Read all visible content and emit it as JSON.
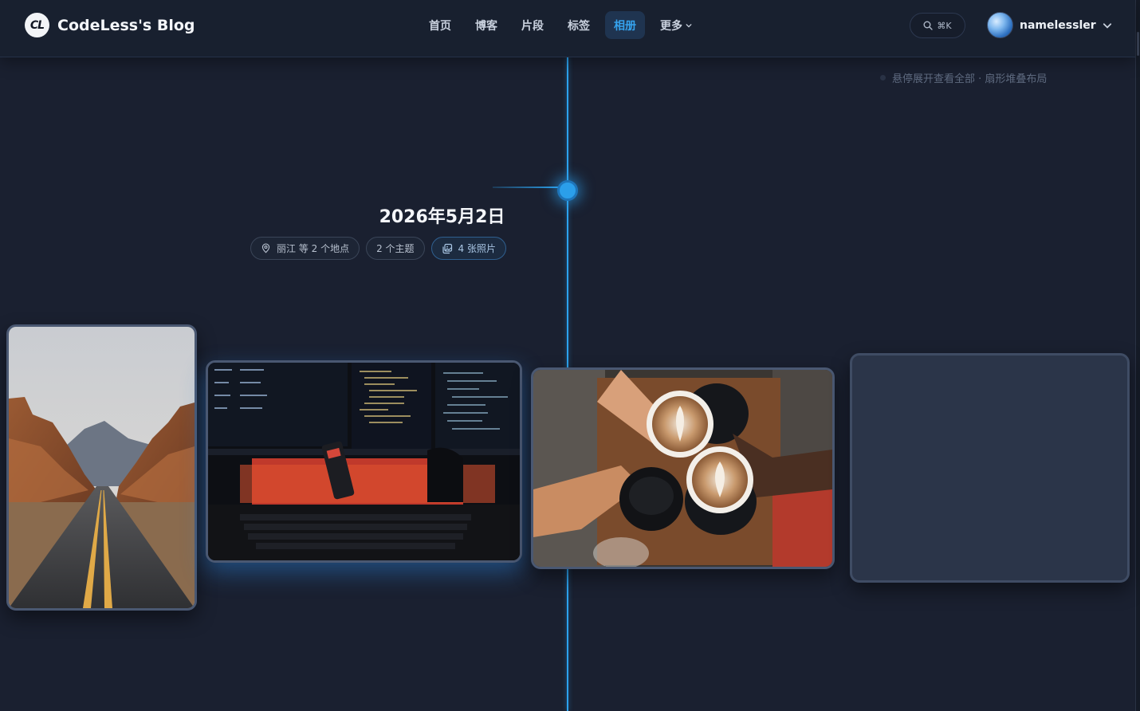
{
  "header": {
    "brand_logo": "CL",
    "brand_name": "CodeLess's Blog",
    "nav": [
      {
        "label": "首页",
        "active": false
      },
      {
        "label": "博客",
        "active": false
      },
      {
        "label": "片段",
        "active": false
      },
      {
        "label": "标签",
        "active": false
      },
      {
        "label": "相册",
        "active": true
      },
      {
        "label": "更多",
        "active": false,
        "has_dropdown": true
      }
    ],
    "search_shortcut": "⌘K",
    "username": "namelessler"
  },
  "hint": "悬停展开查看全部 · 扇形堆叠布局",
  "album": {
    "date": "2026年5月2日",
    "chips": {
      "location": "丽江 等 2 个地点",
      "topics": "2 个主题",
      "photos": "4 张照片"
    },
    "photos": [
      {
        "subject": "desert-road"
      },
      {
        "subject": "code-workstation"
      },
      {
        "subject": "latte-cheers"
      },
      {
        "subject": "placeholder"
      }
    ]
  },
  "colors": {
    "background": "#1a2030",
    "accent": "#2ca2ee",
    "nav_active": "#35a3ee"
  },
  "icons": [
    "search-icon",
    "chevron-down-icon",
    "location-pin-icon",
    "photo-stack-icon"
  ]
}
